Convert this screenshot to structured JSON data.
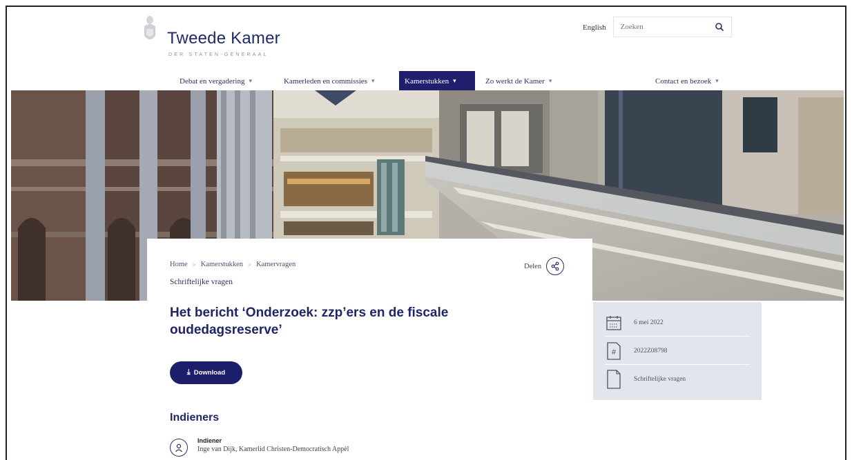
{
  "header": {
    "logo_title": "Tweede Kamer",
    "logo_subtitle": "DER STATEN-GENERAAL",
    "language_link": "English",
    "search_placeholder": "Zoeken",
    "search_icon": "search-icon"
  },
  "nav": {
    "items": [
      {
        "label": "Debat en vergadering",
        "active": false
      },
      {
        "label": "Kamerleden en commissies",
        "active": false
      },
      {
        "label": "Kamerstukken",
        "active": true
      },
      {
        "label": "Zo werkt de Kamer",
        "active": false
      },
      {
        "label": "Contact en bezoek",
        "active": false
      }
    ],
    "chevron": "▾"
  },
  "breadcrumb": [
    "Home",
    "Kamerstukken",
    "Kamervragen"
  ],
  "breadcrumb_separator": ">",
  "doc_type": "Schriftelijke vragen",
  "share_label": "Delen",
  "title": "Het bericht ‘Onderzoek: zzp’ers en de fiscale oudedagsreserve’",
  "download_label": "Download",
  "indieners": {
    "heading": "Indieners",
    "label": "Indiener",
    "value": "Inge van Dijk, Kamerlid Christen-Democratisch Appèl"
  },
  "meta": {
    "date": "6 mei 2022",
    "number": "2022Z08798",
    "type": "Schriftelijke vragen"
  },
  "colors": {
    "primary": "#1d1e6a",
    "meta_bg": "#e2e6ec"
  }
}
